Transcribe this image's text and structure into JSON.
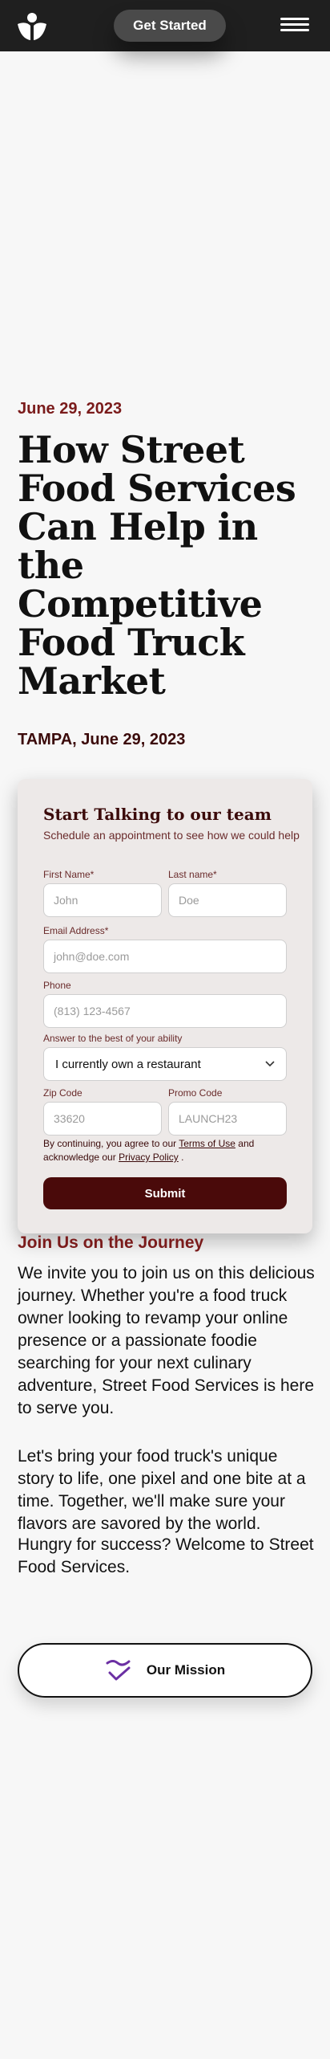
{
  "header": {
    "get_started_label": "Get Started"
  },
  "article": {
    "date": "June 29, 2023",
    "title": "How Street Food Services Can Help in the Competitive Food Truck Market",
    "dateline": "TAMPA, June 29, 2023"
  },
  "form": {
    "title": "Start Talking to our team",
    "subtitle": "Schedule an appointment to see how we could help",
    "first_name_label": "First Name*",
    "first_name_placeholder": "John",
    "last_name_label": "Last name*",
    "last_name_placeholder": "Doe",
    "email_label": "Email Address*",
    "email_placeholder": "john@doe.com",
    "phone_label": "Phone",
    "phone_placeholder": "(813) 123-4567",
    "answer_label": "Answer to the best of your ability",
    "answer_selected": "I currently own a restaurant",
    "zip_label": "Zip Code",
    "zip_placeholder": "33620",
    "promo_label": "Promo Code",
    "promo_placeholder": "LAUNCH23",
    "consent_prefix": "By continuing, you agree to our",
    "terms_link": "Terms of Use",
    "consent_middle": "and acknowledge our",
    "privacy_link": "Privacy Policy",
    "consent_suffix": ".",
    "submit_label": "Submit"
  },
  "journey": {
    "heading": "Join Us on the Journey",
    "paragraph1": "We invite you to join us on this delicious journey. Whether you're a food truck owner looking to revamp your online presence or a passionate foodie searching for your next culinary adventure, Street Food Services is here to serve you.",
    "paragraph2": "Let's bring your food truck's unique story to life, one pixel and one bite at a time. Together, we'll make sure your flavors are savored by the world.",
    "paragraph3": "Hungry for success? Welcome to Street Food Services."
  },
  "mission_button": {
    "label": "Our Mission",
    "icon": "check-wave-icon",
    "icon_color": "#6b2fa3"
  },
  "colors": {
    "header_bg": "#1f1f1f",
    "accent": "#7a1b1b",
    "submit_bg": "#4a0a0a"
  }
}
